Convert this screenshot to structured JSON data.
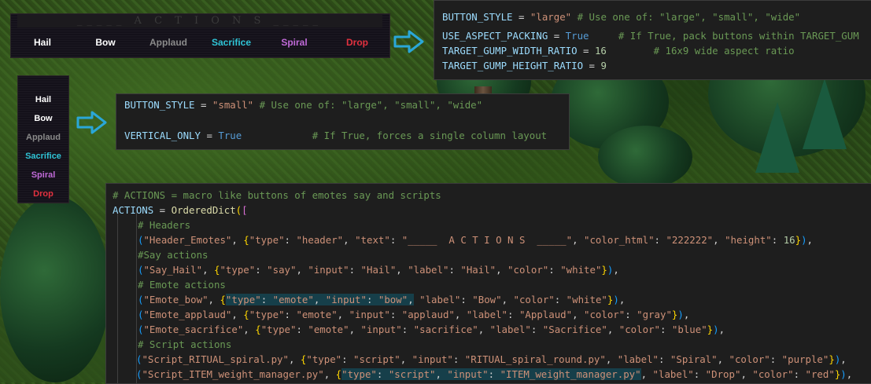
{
  "wide_gump": {
    "header": "_____  A C T I O N S  _____",
    "buttons": [
      {
        "label": "Hail",
        "color": "white"
      },
      {
        "label": "Bow",
        "color": "white"
      },
      {
        "label": "Applaud",
        "color": "gray"
      },
      {
        "label": "Sacrifice",
        "color": "blue"
      },
      {
        "label": "Spiral",
        "color": "purple"
      },
      {
        "label": "Drop",
        "color": "red"
      }
    ]
  },
  "small_gump": {
    "buttons": [
      {
        "label": "Hail",
        "color": "white"
      },
      {
        "label": "Bow",
        "color": "white"
      },
      {
        "label": "Applaud",
        "color": "gray"
      },
      {
        "label": "Sacrifice",
        "color": "blue"
      },
      {
        "label": "Spiral",
        "color": "purple"
      },
      {
        "label": "Drop",
        "color": "red"
      }
    ]
  },
  "config_large": {
    "line1_var": "BUTTON_STYLE",
    "line1_eq": " = ",
    "line1_val": "\"large\"",
    "line1_comment": " # Use one of: \"large\", \"small\", \"wide\"",
    "line2_var": "USE_ASPECT_PACKING",
    "line2_eq": " = ",
    "line2_val": "True",
    "line2_comment": "     # If True, pack buttons within TARGET_GUM",
    "line3_var": "TARGET_GUMP_WIDTH_RATIO",
    "line3_eq": " = ",
    "line3_val": "16",
    "line3_comment": "        # 16x9 wide aspect ratio",
    "line4_var": "TARGET_GUMP_HEIGHT_RATIO",
    "line4_eq": " = ",
    "line4_val": "9"
  },
  "config_small": {
    "line1_var": "BUTTON_STYLE",
    "line1_eq": " = ",
    "line1_val": "\"small\"",
    "line1_comment": " # Use one of: \"large\", \"small\", \"wide\"",
    "line2_var": "VERTICAL_ONLY",
    "line2_eq": " = ",
    "line2_val": "True",
    "line2_comment": "            # If True, forces a single column layout"
  },
  "actions_code": {
    "comment_top": "# ACTIONS = macro like buttons of emotes say and scripts",
    "actions_var": "ACTIONS",
    "eq": " = ",
    "ordered_dict": "OrderedDict",
    "comment_headers": "# Headers",
    "comment_say": "#Say actions",
    "comment_emote": "# Emote actions",
    "comment_script": "# Script actions",
    "header_key": "\"Header_Emotes\"",
    "header_text": "\"_____  A C T I O N S  _____\"",
    "header_color": "\"222222\"",
    "header_height": "16",
    "say_key": "\"Say_Hail\"",
    "say_input": "\"Hail\"",
    "say_label": "\"Hail\"",
    "say_color": "\"white\"",
    "bow_key": "\"Emote_bow\"",
    "bow_input": "\"bow\"",
    "bow_label": "\"Bow\"",
    "bow_color": "\"white\"",
    "applaud_key": "\"Emote_applaud\"",
    "applaud_input": "\"applaud\"",
    "applaud_label": "\"Applaud\"",
    "applaud_color": "\"gray\"",
    "sacrifice_key": "\"Emote_sacrifice\"",
    "sacrifice_input": "\"sacrifice\"",
    "sacrifice_label": "\"Sacrifice\"",
    "sacrifice_color": "\"blue\"",
    "spiral_key": "\"Script_RITUAL_spiral.py\"",
    "spiral_input": "\"RITUAL_spiral_round.py\"",
    "spiral_label": "\"Spiral\"",
    "spiral_color": "\"purple\"",
    "drop_key": "\"Script_ITEM_weight_manager.py\"",
    "drop_input": "\"ITEM_weight_manager.py\"",
    "drop_label": "\"Drop\"",
    "drop_color": "\"red\"",
    "k_type": "\"type\"",
    "k_text": "\"text\"",
    "k_color_html": "\"color_html\"",
    "k_height": "\"height\"",
    "k_input": "\"input\"",
    "k_label": "\"label\"",
    "k_color": "\"color\"",
    "v_header": "\"header\"",
    "v_say": "\"say\"",
    "v_emote": "\"emote\"",
    "v_script": "\"script\""
  },
  "colors": {
    "white": "#ffffff",
    "gray": "#8a8a8a",
    "blue": "#2fc4d6",
    "purple": "#c06ad8",
    "red": "#e2313f",
    "arrow": "#2aa7d8",
    "code_bg": "#1e1e1e"
  },
  "icons": [
    "arrow-right-icon",
    "arrow-right-icon"
  ]
}
